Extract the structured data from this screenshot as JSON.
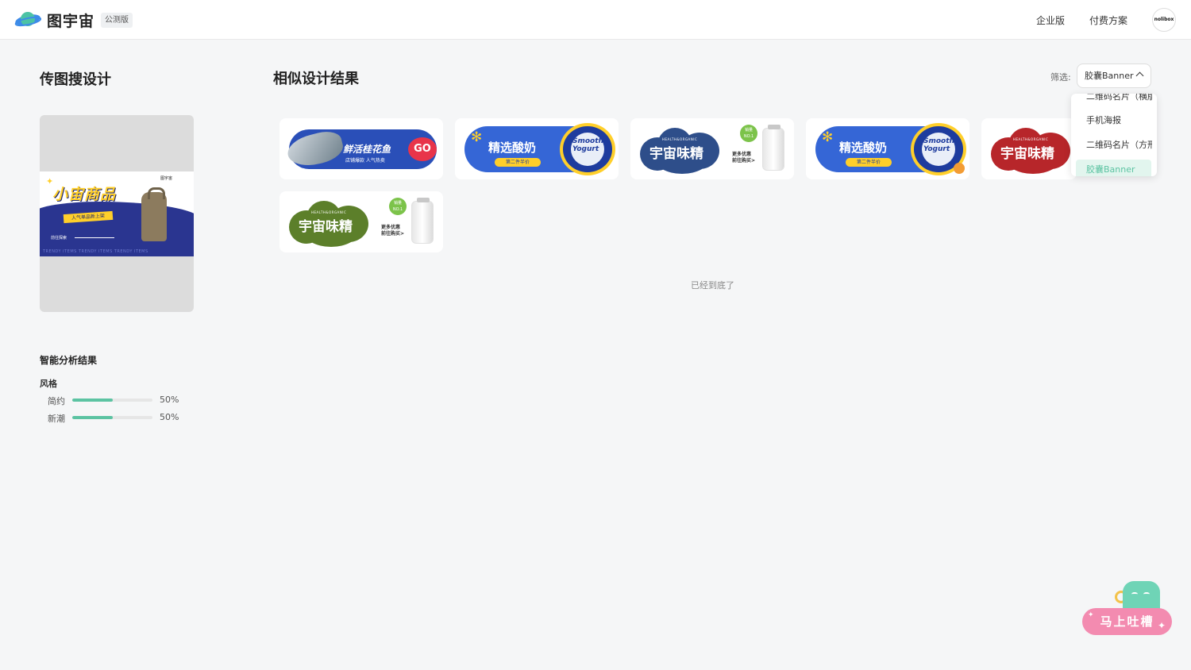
{
  "header": {
    "brand": "图宇宙",
    "beta_badge": "公测版",
    "nav": [
      "企业版",
      "付费方案"
    ],
    "avatar_text": "nolibox",
    "logo_icon": "planet-logo-icon"
  },
  "left": {
    "title": "传图搜设计",
    "uploaded_image": {
      "headline": "小宙商品",
      "tag": "人气单品新上架",
      "sub": "前往探索",
      "footer": "TRENDY ITEMS   TRENDY ITEMS   TRENDY ITEMS",
      "brand": "图宇宙"
    },
    "analysis_title": "智能分析结果",
    "style_label": "风格",
    "stats": [
      {
        "name": "简约",
        "value": "50%",
        "fraction": 0.5
      },
      {
        "name": "新潮",
        "value": "50%",
        "fraction": 0.5
      }
    ]
  },
  "main": {
    "title": "相似设计结果",
    "filter_label": "筛选:",
    "filter_value": "胶囊Banner",
    "dropdown": [
      "二维码名片（横版）",
      "手机海报",
      "二维码名片（方形）",
      "胶囊Banner"
    ],
    "bottom_note": "已经到底了",
    "cards": [
      {
        "kind": "fish",
        "title": "鲜活桂花鱼",
        "sub": "店铺爆款 人气热卖",
        "cta": "GO"
      },
      {
        "kind": "yogurt",
        "title": "精选酸奶",
        "badge": "第二件半价",
        "cup_text": "Smooth Yogurt"
      },
      {
        "kind": "weijing",
        "color": "#2e4e8a",
        "title": "宇宙味精",
        "head": "HEALTH&ORGANIC",
        "promo1": "更多优惠",
        "promo2": "前往购买>",
        "seal": "销量 NO.1"
      },
      {
        "kind": "yogurt",
        "title": "精选酸奶",
        "badge": "第二件半价",
        "cup_text": "Smooth Yogurt"
      },
      {
        "kind": "weijing",
        "color": "#b7262a",
        "title": "宇宙味精",
        "head": "HEALTH&ORGANIC"
      },
      {
        "kind": "weijing",
        "color": "#5c7f2a",
        "title": "宇宙味精",
        "head": "HEALTH&ORGANIC",
        "promo1": "更多优惠",
        "promo2": "前往购买>",
        "seal": "销量 NO.1"
      }
    ]
  },
  "feedback": {
    "label": "马上吐槽"
  }
}
